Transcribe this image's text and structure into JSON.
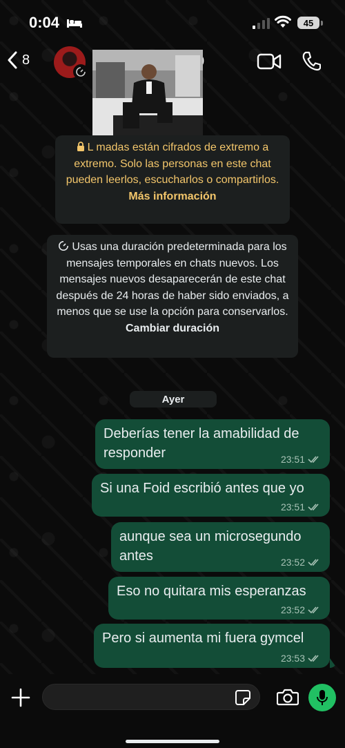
{
  "status_bar": {
    "time": "0:04",
    "battery": "45"
  },
  "header": {
    "back_count": "8",
    "contact_name": "0"
  },
  "notices": {
    "encryption_text": "L madas están cifrados de extremo a extremo. Solo las personas en este chat pueden leerlos, escucharlos o compartirlos.",
    "encryption_link": "Más información",
    "temporary_text": "Usas una duración predeterminada para los mensajes temporales en chats nuevos. Los mensajes nuevos desaparecerán de este chat después de 24 horas de haber sido enviados, a menos que se use la opción para conservarlos.",
    "temporary_link": "Cambiar duración"
  },
  "date_separator": "Ayer",
  "messages": [
    {
      "text": "Deberías tener la amabilidad de responder",
      "time": "23:51"
    },
    {
      "text": "Si una Foid escribió antes que yo",
      "time": "23:51"
    },
    {
      "text": "aunque sea un microsegundo antes",
      "time": "23:52"
    },
    {
      "text": "Eso no quitara mis esperanzas",
      "time": "23:52"
    },
    {
      "text": "Pero si aumenta mi fuera gymcel",
      "time": "23:53"
    }
  ],
  "composer": {
    "placeholder": ""
  },
  "colors": {
    "bubble": "#134d37",
    "accent": "#21c063",
    "notice_text": "#f3c66b"
  },
  "icons": [
    "bed-icon",
    "signal-icon",
    "wifi-icon",
    "chevron-left-icon",
    "timer-icon",
    "video-icon",
    "phone-icon",
    "lock-icon",
    "double-check-icon",
    "plus-icon",
    "sticker-icon",
    "camera-icon",
    "mic-icon"
  ]
}
